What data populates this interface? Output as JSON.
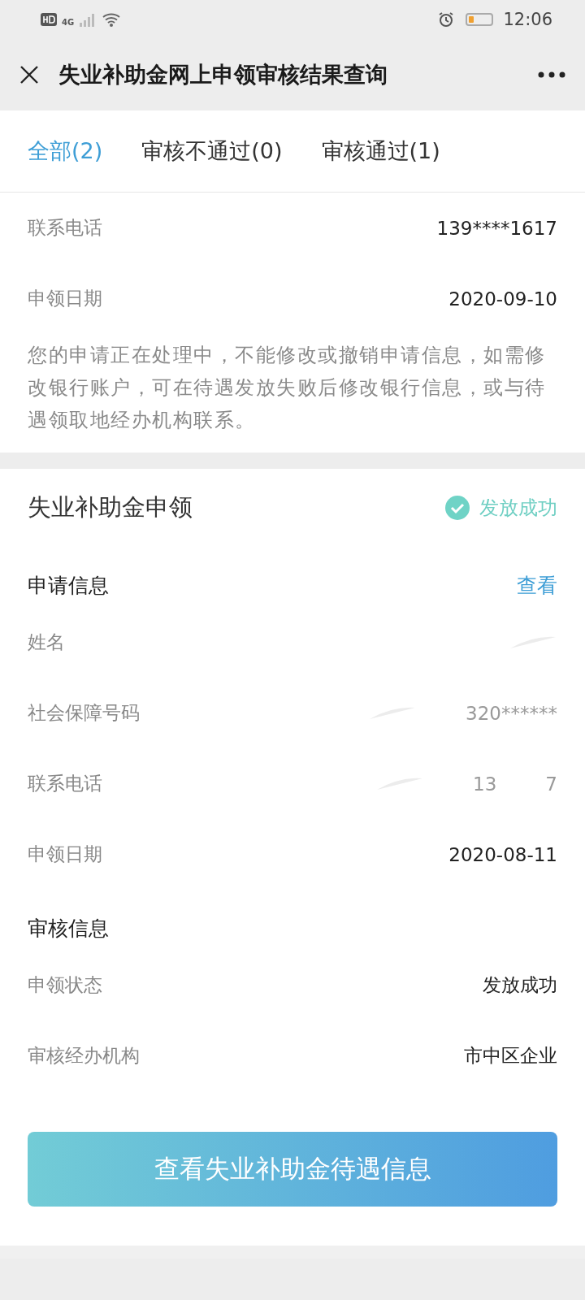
{
  "status_bar": {
    "network": "4G",
    "time": "12:06",
    "battery": {
      "level": 0.2
    }
  },
  "header": {
    "title": "失业补助金网上申领审核结果查询"
  },
  "tabs": [
    {
      "label": "全部(2)",
      "selected": true
    },
    {
      "label": "审核不通过(0)",
      "selected": false
    },
    {
      "label": "审核通过(1)",
      "selected": false
    }
  ],
  "summary": {
    "rows": [
      {
        "label": "联系电话",
        "value": "139****1617"
      },
      {
        "label": "申领日期",
        "value": "2020-09-10"
      }
    ],
    "notice": "您的申请正在处理中，不能修改或撤销申请信息，如需修改银行账户，可在待遇发放失败后修改银行信息，或与待遇领取地经办机构联系。"
  },
  "card": {
    "title": "失业补助金申领",
    "status": "发放成功",
    "sections": [
      {
        "title": "申请信息",
        "link": "查看",
        "rows": [
          {
            "label": "姓名",
            "values": [],
            "smudged": true
          },
          {
            "label": "社会保障号码",
            "values": [
              "320******"
            ],
            "smudged": true
          },
          {
            "label": "联系电话",
            "values": [
              "13",
              "7"
            ],
            "smudged": true
          },
          {
            "label": "申领日期",
            "values": [
              "2020-08-11"
            ],
            "smudged": false
          }
        ]
      },
      {
        "title": "审核信息",
        "rows": [
          {
            "label": "申领状态",
            "values": [
              "发放成功"
            ],
            "smudged": false
          },
          {
            "label": "审核经办机构",
            "values": [
              "市中区企业"
            ],
            "smudged": false
          }
        ]
      }
    ],
    "button": "查看失业补助金待遇信息"
  }
}
